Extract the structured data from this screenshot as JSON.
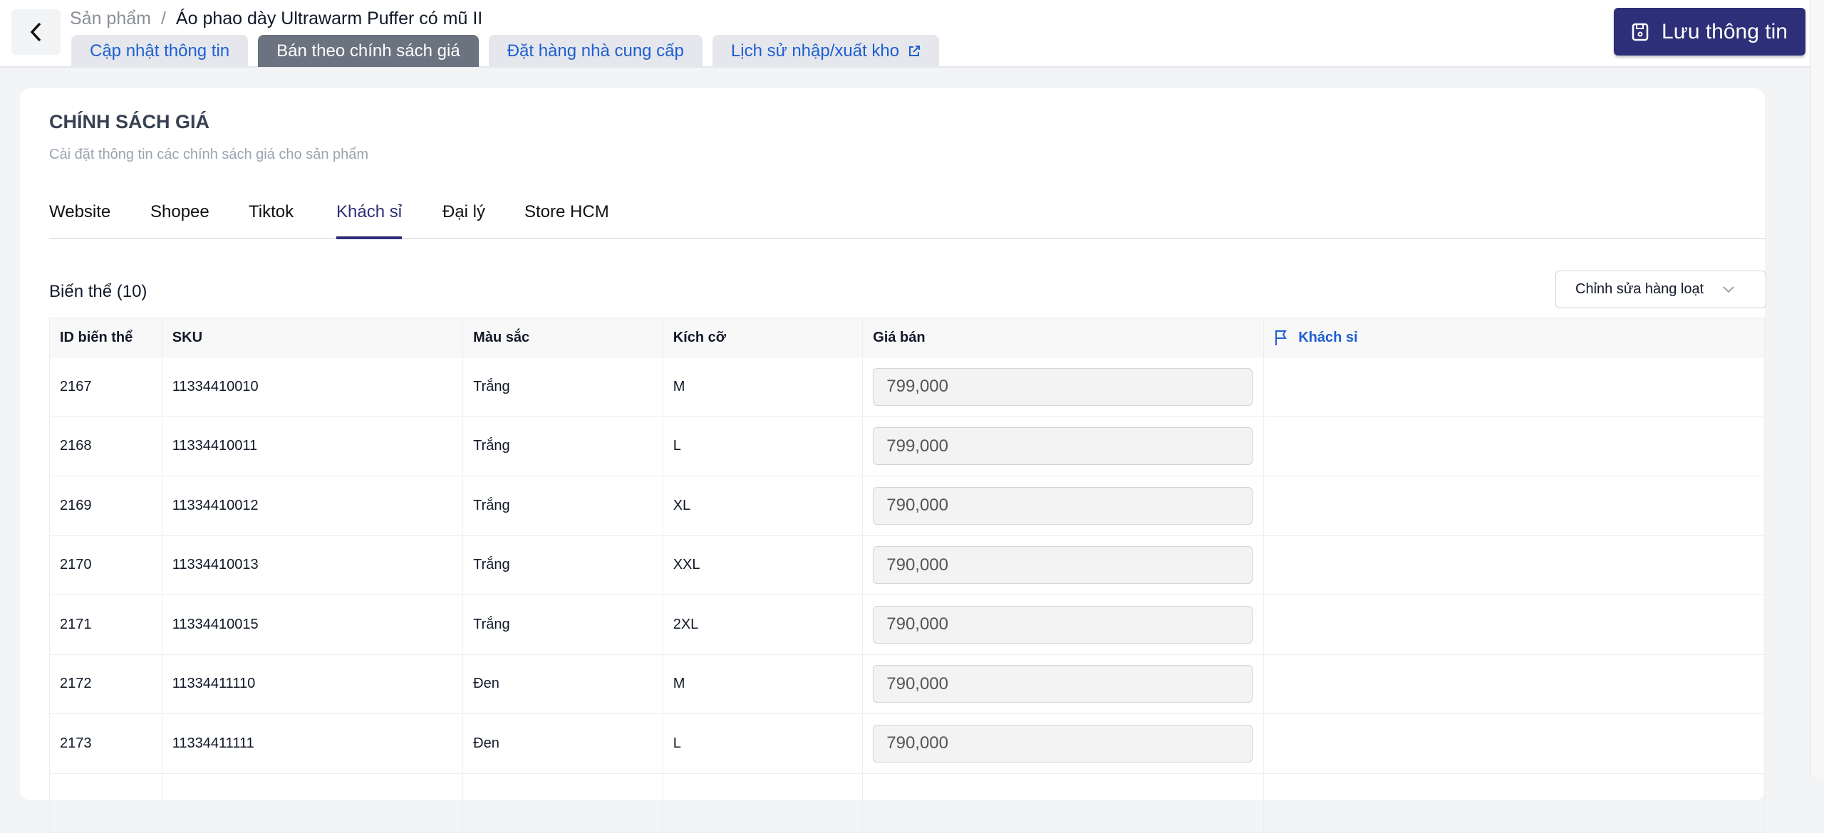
{
  "breadcrumb": {
    "parent": "Sản phẩm",
    "separator": "/",
    "current": "Áo phao dày Ultrawarm Puffer có mũ II"
  },
  "top_tabs": [
    "Cập nhật thông tin",
    "Bán theo chính sách giá",
    "Đặt hàng nhà cung cấp",
    "Lịch sử nhập/xuất kho"
  ],
  "save_label": "Lưu thông tin",
  "section": {
    "title": "CHÍNH SÁCH GIÁ",
    "subtitle": "Cài đặt thông tin các chính sách giá cho sản phẩm"
  },
  "policy_tabs": [
    "Website",
    "Shopee",
    "Tiktok",
    "Khách sỉ",
    "Đại lý",
    "Store HCM"
  ],
  "variants_label": "Biến thể (10)",
  "bulk_edit_label": "Chỉnh sửa hàng loạt",
  "columns": [
    "ID biến thể",
    "SKU",
    "Màu sắc",
    "Kích cỡ",
    "Giá bán",
    "Khách sỉ"
  ],
  "rows": [
    {
      "id": "2167",
      "sku": "11334410010",
      "color": "Trắng",
      "size": "M",
      "price": "799,000"
    },
    {
      "id": "2168",
      "sku": "11334410011",
      "color": "Trắng",
      "size": "L",
      "price": "799,000"
    },
    {
      "id": "2169",
      "sku": "11334410012",
      "color": "Trắng",
      "size": "XL",
      "price": "790,000"
    },
    {
      "id": "2170",
      "sku": "11334410013",
      "color": "Trắng",
      "size": "XXL",
      "price": "790,000"
    },
    {
      "id": "2171",
      "sku": "11334410015",
      "color": "Trắng",
      "size": "2XL",
      "price": "790,000"
    },
    {
      "id": "2172",
      "sku": "11334411110",
      "color": "Đen",
      "size": "M",
      "price": "790,000"
    },
    {
      "id": "2173",
      "sku": "11334411111",
      "color": "Đen",
      "size": "L",
      "price": "790,000"
    }
  ],
  "colors": {
    "primary": "#2d2f78",
    "link": "#1d5fd1"
  }
}
